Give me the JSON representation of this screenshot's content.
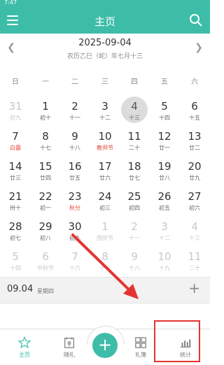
{
  "status": {
    "time": "7:47"
  },
  "header": {
    "title": "主页"
  },
  "datebar": {
    "date": "2025-09-04",
    "lunar": "农历乙巳（蛇）年七月十三"
  },
  "weekdays": [
    "日",
    "一",
    "二",
    "三",
    "四",
    "五",
    "六"
  ],
  "calendar": [
    [
      {
        "n": "31",
        "l": "初九",
        "dim": true
      },
      {
        "n": "1",
        "l": "初十"
      },
      {
        "n": "2",
        "l": "十一"
      },
      {
        "n": "3",
        "l": "十二"
      },
      {
        "n": "4",
        "l": "十三",
        "sel": true
      },
      {
        "n": "5",
        "l": "十四"
      },
      {
        "n": "6",
        "l": "十五"
      }
    ],
    [
      {
        "n": "7",
        "l": "白露",
        "red": true
      },
      {
        "n": "8",
        "l": "十七"
      },
      {
        "n": "9",
        "l": "十八"
      },
      {
        "n": "10",
        "l": "教师节",
        "red": true
      },
      {
        "n": "11",
        "l": "二十"
      },
      {
        "n": "12",
        "l": "廿一"
      },
      {
        "n": "13",
        "l": "廿二"
      }
    ],
    [
      {
        "n": "14",
        "l": "廿三"
      },
      {
        "n": "15",
        "l": "廿四"
      },
      {
        "n": "16",
        "l": "廿五"
      },
      {
        "n": "17",
        "l": "廿六"
      },
      {
        "n": "18",
        "l": "廿七"
      },
      {
        "n": "19",
        "l": "廿八"
      },
      {
        "n": "20",
        "l": "廿九"
      }
    ],
    [
      {
        "n": "21",
        "l": "卅十"
      },
      {
        "n": "22",
        "l": "初一"
      },
      {
        "n": "23",
        "l": "秋分",
        "red": true
      },
      {
        "n": "24",
        "l": "初三"
      },
      {
        "n": "25",
        "l": "初四"
      },
      {
        "n": "26",
        "l": "初五"
      },
      {
        "n": "27",
        "l": "初六"
      }
    ],
    [
      {
        "n": "28",
        "l": "初七"
      },
      {
        "n": "29",
        "l": "初八"
      },
      {
        "n": "30",
        "l": "初九"
      },
      {
        "n": "1",
        "l": "国庆节",
        "dim": true
      },
      {
        "n": "2",
        "l": "十一",
        "dim": true
      },
      {
        "n": "3",
        "l": "十二",
        "dim": true
      },
      {
        "n": "4",
        "l": "十三",
        "dim": true
      }
    ],
    [
      {
        "n": "5",
        "l": "十四",
        "dim": true
      },
      {
        "n": "6",
        "l": "中秋节",
        "dim": true
      },
      {
        "n": "7",
        "l": "十六",
        "dim": true
      },
      {
        "n": "8",
        "l": "十七",
        "dim": true
      },
      {
        "n": "9",
        "l": "十八",
        "dim": true
      },
      {
        "n": "10",
        "l": "十九",
        "dim": true
      },
      {
        "n": "11",
        "l": "二十",
        "dim": true
      }
    ]
  ],
  "events": {
    "date": "09.04",
    "weekday": "星期四",
    "add": "+"
  },
  "tabs": {
    "home": "主页",
    "gift_record": "随礼",
    "book": "礼簿",
    "stats": "统计",
    "fab": "+"
  },
  "colors": {
    "accent": "#3dbda8",
    "highlight": "#e53333",
    "festival": "#e04a3a"
  }
}
